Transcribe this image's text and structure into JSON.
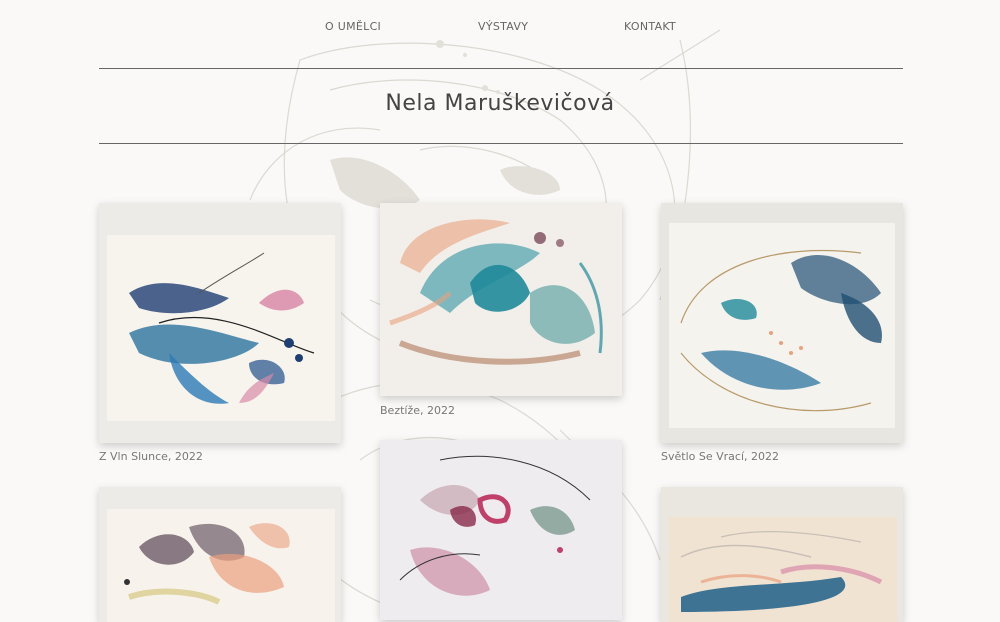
{
  "nav": {
    "items": [
      {
        "label": "O UMĚLCI"
      },
      {
        "label": "VÝSTAVY"
      },
      {
        "label": "KONTAKT"
      }
    ]
  },
  "page": {
    "title": "Nela Maruškevičová"
  },
  "gallery": {
    "items": [
      {
        "caption": "Z Vln Slunce, 2022"
      },
      {
        "caption": "Beztíže, 2022"
      },
      {
        "caption": "Světlo Se Vrací, 2022"
      },
      {
        "caption": ""
      },
      {
        "caption": ""
      },
      {
        "caption": ""
      }
    ]
  },
  "colors": {
    "background": "#faf9f7",
    "text": "#555555",
    "rule": "#666666",
    "teal": "#1f8a9a",
    "navy": "#1f3f73",
    "pink": "#d98aa8",
    "peach": "#e9a07e"
  }
}
